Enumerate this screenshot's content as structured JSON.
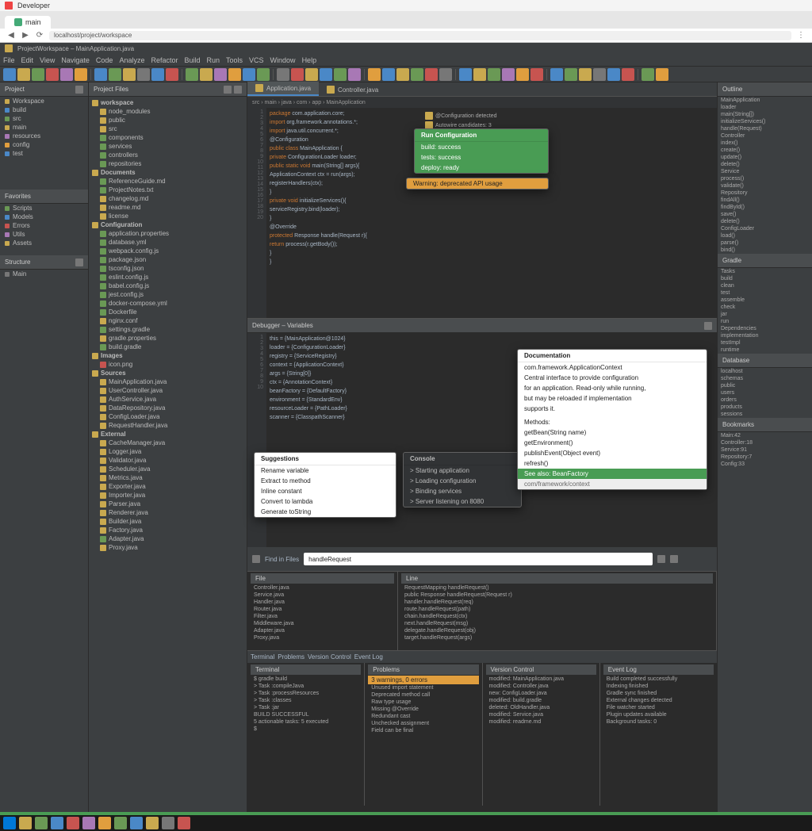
{
  "os": {
    "title": "Developer"
  },
  "browser": {
    "tabs": [
      {
        "label": "main"
      }
    ],
    "url": "localhost/project/workspace"
  },
  "ide": {
    "title": "ProjectWorkspace – MainApplication.java",
    "menu": [
      "File",
      "Edit",
      "View",
      "Navigate",
      "Code",
      "Analyze",
      "Refactor",
      "Build",
      "Run",
      "Tools",
      "VCS",
      "Window",
      "Help"
    ],
    "toolbar_colors": [
      "#4a88c7",
      "#c9a94f",
      "#6a9955",
      "#c75450",
      "#a878b5",
      "#e09e3e",
      "#4a88c7",
      "#6a9955",
      "#c9a94f",
      "#777",
      "#4a88c7",
      "#c75450",
      "#6a9955",
      "#c9a94f",
      "#a878b5",
      "#e09e3e",
      "#4a88c7",
      "#6a9955",
      "#777",
      "#c75450",
      "#c9a94f",
      "#4a88c7",
      "#6a9955",
      "#a878b5",
      "#e09e3e",
      "#4a88c7",
      "#c9a94f",
      "#6a9955",
      "#c75450",
      "#777",
      "#4a88c7",
      "#c9a94f",
      "#6a9955",
      "#a878b5",
      "#e09e3e",
      "#c75450",
      "#4a88c7",
      "#6a9955",
      "#c9a94f",
      "#777",
      "#4a88c7",
      "#c75450",
      "#6a9955",
      "#e09e3e"
    ]
  },
  "far_left": {
    "header1": "Project",
    "group1": [
      {
        "c": "#c9a94f",
        "t": "Workspace"
      },
      {
        "c": "#4a88c7",
        "t": "build"
      },
      {
        "c": "#6a9955",
        "t": "src"
      },
      {
        "c": "#c9a94f",
        "t": "main"
      },
      {
        "c": "#a878b5",
        "t": "resources"
      },
      {
        "c": "#e09e3e",
        "t": "config"
      },
      {
        "c": "#4a88c7",
        "t": "test"
      }
    ],
    "header2": "Favorites",
    "group2": [
      {
        "c": "#6a9955",
        "t": "Scripts"
      },
      {
        "c": "#4a88c7",
        "t": "Models"
      },
      {
        "c": "#c75450",
        "t": "Errors"
      },
      {
        "c": "#a878b5",
        "t": "Utils"
      },
      {
        "c": "#c9a94f",
        "t": "Assets"
      }
    ],
    "header3": "Structure",
    "group3": [
      {
        "c": "#777",
        "t": "Main"
      }
    ]
  },
  "project": {
    "header": "Project Files",
    "sections": [
      {
        "title": "workspace",
        "items": [
          {
            "c": "#c9a94f",
            "t": "node_modules"
          },
          {
            "c": "#c9a94f",
            "t": "public"
          },
          {
            "c": "#c9a94f",
            "t": "src"
          },
          {
            "c": "#6a9955",
            "t": "components"
          },
          {
            "c": "#6a9955",
            "t": "services"
          },
          {
            "c": "#6a9955",
            "t": "controllers"
          },
          {
            "c": "#6a9955",
            "t": "repositories"
          }
        ]
      },
      {
        "title": "Documents",
        "items": [
          {
            "c": "#6a9955",
            "t": "ReferenceGuide.md"
          },
          {
            "c": "#6a9955",
            "t": "ProjectNotes.txt"
          },
          {
            "c": "#c9a94f",
            "t": "changelog.md"
          },
          {
            "c": "#c9a94f",
            "t": "readme.md"
          },
          {
            "c": "#c9a94f",
            "t": "license"
          }
        ]
      },
      {
        "title": "Configuration",
        "items": [
          {
            "c": "#6a9955",
            "t": "application.properties"
          },
          {
            "c": "#6a9955",
            "t": "database.yml"
          },
          {
            "c": "#6a9955",
            "t": "webpack.config.js"
          },
          {
            "c": "#6a9955",
            "t": "package.json"
          },
          {
            "c": "#6a9955",
            "t": "tsconfig.json"
          },
          {
            "c": "#6a9955",
            "t": "eslint.config.js"
          },
          {
            "c": "#6a9955",
            "t": "babel.config.js"
          },
          {
            "c": "#6a9955",
            "t": "jest.config.js"
          },
          {
            "c": "#6a9955",
            "t": "docker-compose.yml"
          },
          {
            "c": "#6a9955",
            "t": "Dockerfile"
          },
          {
            "c": "#c9a94f",
            "t": "nginx.conf"
          },
          {
            "c": "#6a9955",
            "t": "settings.gradle"
          },
          {
            "c": "#c9a94f",
            "t": "gradle.properties"
          },
          {
            "c": "#6a9955",
            "t": "build.gradle"
          }
        ]
      },
      {
        "title": "Images",
        "items": [
          {
            "c": "#c75450",
            "t": "icon.png"
          }
        ]
      },
      {
        "title": "Sources",
        "items": [
          {
            "c": "#c9a94f",
            "t": "MainApplication.java"
          },
          {
            "c": "#c9a94f",
            "t": "UserController.java"
          },
          {
            "c": "#c9a94f",
            "t": "AuthService.java"
          },
          {
            "c": "#c9a94f",
            "t": "DataRepository.java"
          },
          {
            "c": "#c9a94f",
            "t": "ConfigLoader.java"
          },
          {
            "c": "#c9a94f",
            "t": "RequestHandler.java"
          }
        ]
      },
      {
        "title": "External",
        "items": [
          {
            "c": "#c9a94f",
            "t": "CacheManager.java"
          },
          {
            "c": "#c9a94f",
            "t": "Logger.java"
          },
          {
            "c": "#c9a94f",
            "t": "Validator.java"
          },
          {
            "c": "#c9a94f",
            "t": "Scheduler.java"
          },
          {
            "c": "#c9a94f",
            "t": "Metrics.java"
          },
          {
            "c": "#c9a94f",
            "t": "Exporter.java"
          },
          {
            "c": "#c9a94f",
            "t": "Importer.java"
          },
          {
            "c": "#c9a94f",
            "t": "Parser.java"
          },
          {
            "c": "#c9a94f",
            "t": "Renderer.java"
          },
          {
            "c": "#c9a94f",
            "t": "Builder.java"
          },
          {
            "c": "#c9a94f",
            "t": "Factory.java"
          },
          {
            "c": "#6a9955",
            "t": "Adapter.java"
          },
          {
            "c": "#c9a94f",
            "t": "Proxy.java"
          }
        ]
      }
    ]
  },
  "editor": {
    "tabs": [
      {
        "label": "Application.java",
        "active": true
      },
      {
        "label": "Controller.java",
        "active": false
      }
    ],
    "breadcrumb": "src › main › java › com › app › MainApplication",
    "top_code": [
      "package com.application.core;",
      "",
      "import org.framework.annotations.*;",
      "import java.util.concurrent.*;",
      "",
      "@Configuration",
      "public class MainApplication {",
      "    private ConfigurationLoader loader;",
      "    public static void main(String[] args){",
      "        ApplicationContext ctx = run(args);",
      "        registerHandlers(ctx);",
      "    }",
      "    private void initializeServices(){",
      "        serviceRegistry.bind(loader);",
      "    }",
      "    @Override",
      "    protected Response handle(Request r){",
      "        return process(r.getBody());",
      "    }",
      "}"
    ],
    "popup_green": {
      "title": "Run Configuration",
      "rows": [
        "build: success",
        "tests: success",
        "deploy: ready"
      ]
    },
    "popup_orange": {
      "rows": [
        "Warning: deprecated API usage"
      ]
    },
    "mid_header": "Debugger – Variables",
    "mid_code": [
      "this = {MainApplication@1024}",
      "  loader = {ConfigurationLoader}",
      "  registry = {ServiceRegistry}",
      "  context = {ApplicationContext}",
      "args = {String[0]}",
      "ctx = {AnnotationContext}",
      "  beanFactory = {DefaultFactory}",
      "  environment = {StandardEnv}",
      "  resourceLoader = {PathLoader}",
      "  scanner  = {ClasspathScanner}"
    ],
    "popup_light_left": {
      "title": "Suggestions",
      "rows": [
        "Rename variable",
        "Extract to method",
        "Inline constant",
        "Convert to lambda",
        "Generate toString"
      ]
    },
    "popup_dark_mid": {
      "title": "Console",
      "rows": [
        "> Starting application",
        "> Loading configuration",
        "> Binding services",
        "> Server listening on 8080"
      ]
    },
    "popup_doc": {
      "title": "Documentation",
      "rows": [
        "com.framework.ApplicationContext",
        "Central interface to provide configuration",
        "for an application. Read-only while running,",
        "but may be reloaded if implementation",
        "supports it.",
        "",
        "Methods:",
        "getBean(String name)",
        "getEnvironment()",
        "publishEvent(Object event)",
        "refresh()"
      ],
      "green_row": "See also: BeanFactory",
      "footer": "com/framework/context"
    },
    "search_header": "Find in Files",
    "search_input": "handleRequest",
    "search_cols": [
      {
        "title": "File",
        "rows": [
          "Controller.java",
          "Service.java",
          "Handler.java",
          "Router.java",
          "Filter.java",
          "Middleware.java",
          "Adapter.java",
          "Proxy.java"
        ]
      },
      {
        "title": "Line",
        "rows": [
          "RequestMapping handleRequest()",
          "public Response handleRequest(Request r)",
          "handler.handleRequest(req)",
          "route.handleRequest(path)",
          "chain.handleRequest(ctx)",
          "next.handleRequest(msg)",
          "delegate.handleRequest(obj)",
          "target.handleRequest(args)"
        ]
      }
    ]
  },
  "lower": {
    "panel1": {
      "title": "Terminal",
      "rows": [
        "$ gradle build",
        "> Task :compileJava",
        "> Task :processResources",
        "> Task :classes",
        "> Task :jar",
        "BUILD SUCCESSFUL",
        "5 actionable tasks: 5 executed",
        "$ "
      ]
    },
    "panel2": {
      "title": "Problems",
      "highlight": "3 warnings, 0 errors",
      "rows": [
        "Unused import statement",
        "Deprecated method call",
        "Raw type usage",
        "Missing @Override",
        "Redundant cast",
        "Unchecked assignment",
        "Field can be final"
      ]
    },
    "panel3": {
      "title": "Version Control",
      "rows": [
        "modified: MainApplication.java",
        "modified: Controller.java",
        "new: ConfigLoader.java",
        "modified: build.gradle",
        "deleted: OldHandler.java",
        "modified: Service.java",
        "modified: readme.md"
      ]
    },
    "panel4": {
      "title": "Event Log",
      "rows": [
        "Build completed successfully",
        "Indexing finished",
        "Gradle sync finished",
        "External changes detected",
        "File watcher started",
        "Plugin updates available",
        "Background tasks: 0"
      ]
    }
  },
  "right": {
    "header1": "Outline",
    "items1": [
      "MainApplication",
      "  loader",
      "  main(String[])",
      "  initializeServices()",
      "  handle(Request)",
      "Controller",
      "  index()",
      "  create()",
      "  update()",
      "  delete()",
      "Service",
      "  process()",
      "  validate()",
      "Repository",
      "  findAll()",
      "  findById()",
      "  save()",
      "  delete()",
      "ConfigLoader",
      "  load()",
      "  parse()",
      "  bind()"
    ],
    "header2": "Gradle",
    "items2": [
      "Tasks",
      "  build",
      "  clean",
      "  test",
      "  assemble",
      "  check",
      "  jar",
      "  run",
      "Dependencies",
      "  implementation",
      "  testImpl",
      "  runtime"
    ],
    "header3": "Database",
    "items3": [
      "localhost",
      "  schemas",
      "    public",
      "      users",
      "      orders",
      "      products",
      "      sessions"
    ],
    "header4": "Bookmarks",
    "items4": [
      "Main:42",
      "Controller:18",
      "Service:91",
      "Repository:7",
      "Config:33"
    ]
  },
  "taskbar": {
    "colors": [
      "#0078d7",
      "#c9a94f",
      "#6a9955",
      "#4a88c7",
      "#c75450",
      "#a878b5",
      "#e09e3e",
      "#6a9955",
      "#4a88c7",
      "#c9a94f",
      "#777",
      "#c75450"
    ]
  }
}
